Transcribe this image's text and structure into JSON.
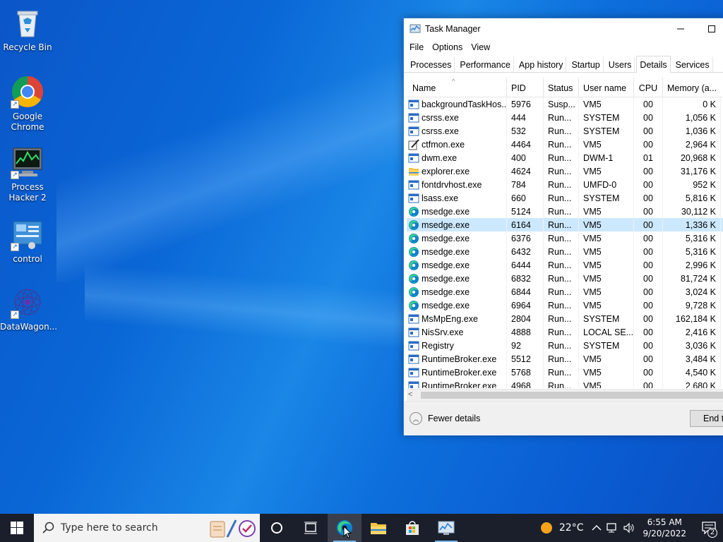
{
  "desktop": {
    "icons": [
      {
        "label": "Recycle Bin"
      },
      {
        "label": "Google Chrome"
      },
      {
        "label": "Process Hacker 2"
      },
      {
        "label": "control"
      },
      {
        "label": "DataWagon..."
      }
    ]
  },
  "task_manager": {
    "title": "Task Manager",
    "window_buttons": {
      "minimize": "—",
      "maximize": "☐"
    },
    "menu": [
      "File",
      "Options",
      "View"
    ],
    "tabs": [
      "Processes",
      "Performance",
      "App history",
      "Startup",
      "Users",
      "Details",
      "Services"
    ],
    "active_tab": "Details",
    "columns": [
      "Name",
      "PID",
      "Status",
      "User name",
      "CPU",
      "Memory (a..."
    ],
    "rows": [
      {
        "name": "backgroundTaskHos...",
        "pid": "5976",
        "status": "Susp...",
        "user": "VM5",
        "cpu": "00",
        "mem": "0 K",
        "icon": "generic"
      },
      {
        "name": "csrss.exe",
        "pid": "444",
        "status": "Run...",
        "user": "SYSTEM",
        "cpu": "00",
        "mem": "1,056 K",
        "icon": "generic"
      },
      {
        "name": "csrss.exe",
        "pid": "532",
        "status": "Run...",
        "user": "SYSTEM",
        "cpu": "00",
        "mem": "1,036 K",
        "icon": "generic"
      },
      {
        "name": "ctfmon.exe",
        "pid": "4464",
        "status": "Run...",
        "user": "VM5",
        "cpu": "00",
        "mem": "2,964 K",
        "icon": "pen"
      },
      {
        "name": "dwm.exe",
        "pid": "400",
        "status": "Run...",
        "user": "DWM-1",
        "cpu": "01",
        "mem": "20,968 K",
        "icon": "generic"
      },
      {
        "name": "explorer.exe",
        "pid": "4624",
        "status": "Run...",
        "user": "VM5",
        "cpu": "00",
        "mem": "31,176 K",
        "icon": "folder"
      },
      {
        "name": "fontdrvhost.exe",
        "pid": "784",
        "status": "Run...",
        "user": "UMFD-0",
        "cpu": "00",
        "mem": "952 K",
        "icon": "generic"
      },
      {
        "name": "lsass.exe",
        "pid": "660",
        "status": "Run...",
        "user": "SYSTEM",
        "cpu": "00",
        "mem": "5,816 K",
        "icon": "generic"
      },
      {
        "name": "msedge.exe",
        "pid": "5124",
        "status": "Run...",
        "user": "VM5",
        "cpu": "00",
        "mem": "30,112 K",
        "icon": "edge"
      },
      {
        "name": "msedge.exe",
        "pid": "6164",
        "status": "Run...",
        "user": "VM5",
        "cpu": "00",
        "mem": "1,336 K",
        "icon": "edge",
        "selected": true
      },
      {
        "name": "msedge.exe",
        "pid": "6376",
        "status": "Run...",
        "user": "VM5",
        "cpu": "00",
        "mem": "5,316 K",
        "icon": "edge"
      },
      {
        "name": "msedge.exe",
        "pid": "6432",
        "status": "Run...",
        "user": "VM5",
        "cpu": "00",
        "mem": "5,316 K",
        "icon": "edge"
      },
      {
        "name": "msedge.exe",
        "pid": "6444",
        "status": "Run...",
        "user": "VM5",
        "cpu": "00",
        "mem": "2,996 K",
        "icon": "edge"
      },
      {
        "name": "msedge.exe",
        "pid": "6832",
        "status": "Run...",
        "user": "VM5",
        "cpu": "00",
        "mem": "81,724 K",
        "icon": "edge"
      },
      {
        "name": "msedge.exe",
        "pid": "6844",
        "status": "Run...",
        "user": "VM5",
        "cpu": "00",
        "mem": "3,024 K",
        "icon": "edge"
      },
      {
        "name": "msedge.exe",
        "pid": "6964",
        "status": "Run...",
        "user": "VM5",
        "cpu": "00",
        "mem": "9,728 K",
        "icon": "edge"
      },
      {
        "name": "MsMpEng.exe",
        "pid": "2804",
        "status": "Run...",
        "user": "SYSTEM",
        "cpu": "00",
        "mem": "162,184 K",
        "icon": "generic"
      },
      {
        "name": "NisSrv.exe",
        "pid": "4888",
        "status": "Run...",
        "user": "LOCAL SE...",
        "cpu": "00",
        "mem": "2,416 K",
        "icon": "generic"
      },
      {
        "name": "Registry",
        "pid": "92",
        "status": "Run...",
        "user": "SYSTEM",
        "cpu": "00",
        "mem": "3,036 K",
        "icon": "generic"
      },
      {
        "name": "RuntimeBroker.exe",
        "pid": "5512",
        "status": "Run...",
        "user": "VM5",
        "cpu": "00",
        "mem": "3,484 K",
        "icon": "generic"
      },
      {
        "name": "RuntimeBroker.exe",
        "pid": "5768",
        "status": "Run...",
        "user": "VM5",
        "cpu": "00",
        "mem": "4,540 K",
        "icon": "generic"
      },
      {
        "name": "RuntimeBroker.exe",
        "pid": "4968",
        "status": "Run...",
        "user": "VM5",
        "cpu": "00",
        "mem": "2,680 K",
        "icon": "generic"
      }
    ],
    "footer": {
      "fewer_details": "Fewer details",
      "end_task": "End t"
    }
  },
  "taskbar": {
    "search_placeholder": "Type here to search",
    "apps": [
      "task-view",
      "edge",
      "file-explorer",
      "microsoft-store",
      "task-manager"
    ],
    "tray": {
      "temperature": "22°C",
      "time": "6:55 AM",
      "date": "9/20/2022",
      "notification_count": "2"
    }
  },
  "colors": {
    "selection": "#cce8ff",
    "taskbar": "#1a1f2b",
    "accent": "#0078d7"
  }
}
